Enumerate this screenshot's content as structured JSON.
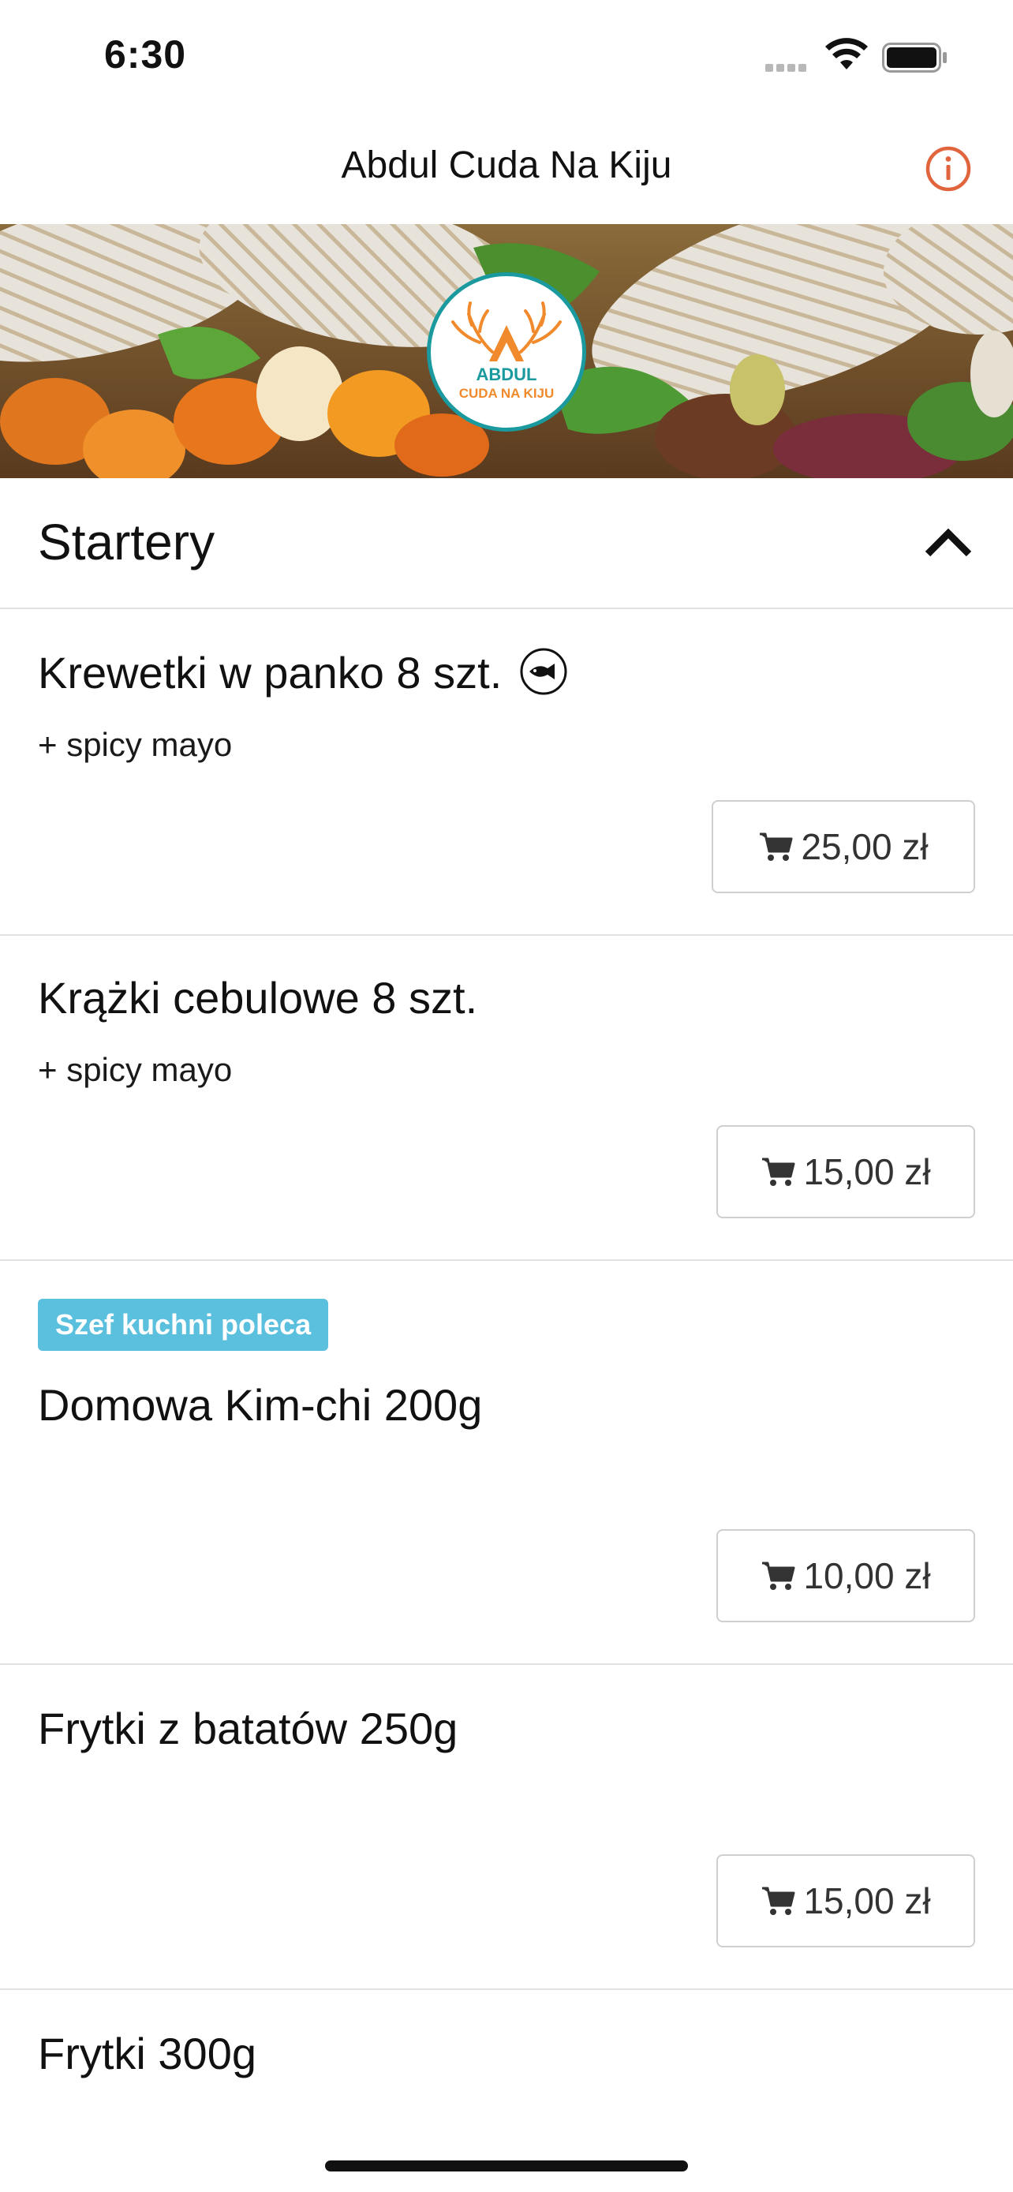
{
  "status_bar": {
    "time": "6:30",
    "icons": [
      "signal-icon",
      "wifi-icon",
      "battery-icon"
    ]
  },
  "nav": {
    "title": "Abdul Cuda Na Kiju",
    "info_icon": "info-icon"
  },
  "hero": {
    "logo_text_line1": "ABDUL",
    "logo_text_line2": "CUDA NA KIJU"
  },
  "section": {
    "title": "Startery",
    "expanded_icon": "chevron-up-icon"
  },
  "items": [
    {
      "name": "Krewetki w panko 8 szt.",
      "description": "+ spicy mayo",
      "price": "25,00 zł",
      "badge": "",
      "icon": "fish-icon"
    },
    {
      "name": "Krążki cebulowe 8 szt.",
      "description": "+ spicy mayo",
      "price": "15,00 zł",
      "badge": ""
    },
    {
      "name": "Domowa Kim-chi 200g",
      "description": "",
      "price": "10,00 zł",
      "badge": "Szef kuchni poleca"
    },
    {
      "name": "Frytki z batatów 250g",
      "description": "",
      "price": "15,00 zł",
      "badge": ""
    },
    {
      "name": "Frytki 300g",
      "description": "",
      "price": "",
      "badge": ""
    }
  ],
  "colors": {
    "accent": "#e0643c",
    "badge": "#5bc0de",
    "logo_ring": "#1a9a9f",
    "logo_orange": "#f08a2c"
  }
}
